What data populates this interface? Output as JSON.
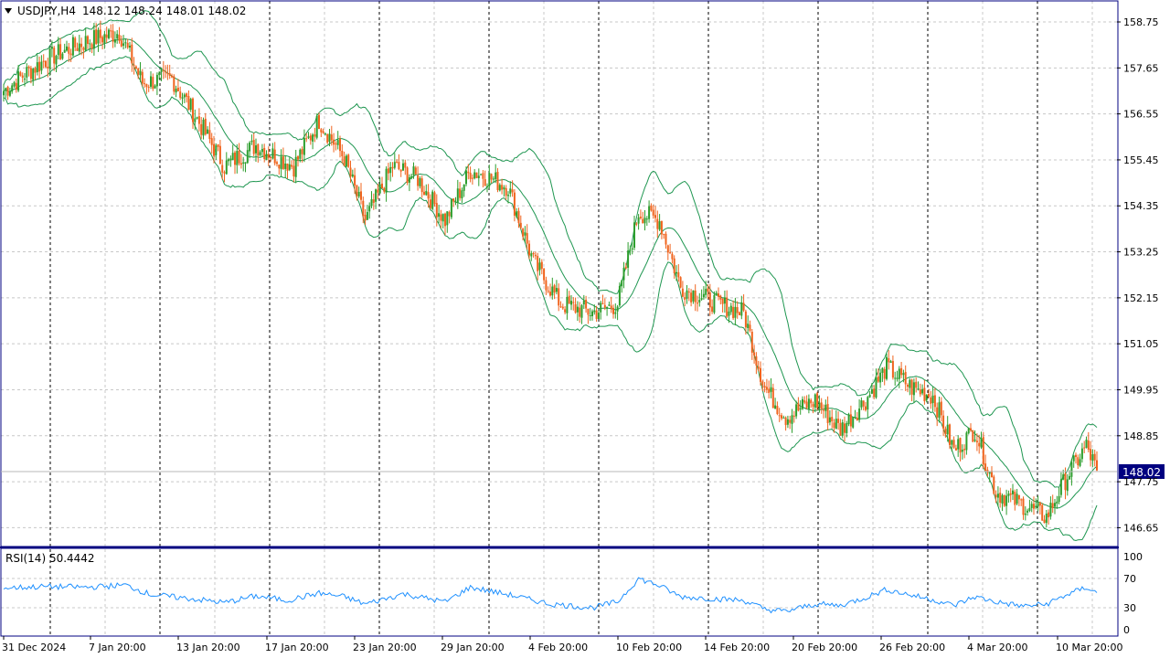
{
  "header": {
    "symbol": "USDJPY,H4",
    "ohlc": "148.12 148.24 148.01 148.02"
  },
  "price_panel": {
    "price_labels": [
      "158.75",
      "157.65",
      "156.55",
      "155.45",
      "154.35",
      "153.25",
      "152.15",
      "151.05",
      "149.95",
      "148.85",
      "147.75",
      "146.65"
    ],
    "current_price": "148.02",
    "current_price_bg": "#000080"
  },
  "rsi_panel": {
    "title": "RSI(14) 50.4442",
    "levels": [
      "100",
      "70",
      "30",
      "0"
    ],
    "line_color": "#1E90FF"
  },
  "time_labels": [
    "31 Dec 2024",
    "7 Jan 20:00",
    "13 Jan 20:00",
    "17 Jan 20:00",
    "23 Jan 20:00",
    "29 Jan 20:00",
    "4 Feb 20:00",
    "10 Feb 20:00",
    "14 Feb 20:00",
    "20 Feb 20:00",
    "26 Feb 20:00",
    "4 Mar 20:00",
    "10 Mar 20:00"
  ],
  "colors": {
    "bull": "#2E9E2E",
    "bear": "#F0641E",
    "bands": "#1E9650",
    "grid": "#C8C8C8",
    "separator": "#000080"
  },
  "chart_data": {
    "type": "candlestick",
    "symbol": "USDJPY",
    "timeframe": "H4",
    "indicators": [
      "Bollinger Bands",
      "RSI(14)"
    ],
    "y_range": [
      146.2,
      159.1
    ],
    "rsi_range": [
      0,
      100
    ],
    "rsi_value": 50.4442,
    "last_close": 148.02,
    "close_path": [
      [
        0,
        157.1
      ],
      [
        10,
        157.5
      ],
      [
        22,
        157.9
      ],
      [
        40,
        158.3
      ],
      [
        55,
        158.5
      ],
      [
        66,
        157.3
      ],
      [
        80,
        157.4
      ],
      [
        90,
        156.6
      ],
      [
        105,
        155.3
      ],
      [
        120,
        155.8
      ],
      [
        138,
        155.3
      ],
      [
        150,
        156.4
      ],
      [
        162,
        155.5
      ],
      [
        172,
        154.0
      ],
      [
        185,
        155.3
      ],
      [
        197,
        155.0
      ],
      [
        210,
        154.0
      ],
      [
        222,
        155.2
      ],
      [
        232,
        155.0
      ],
      [
        240,
        154.8
      ],
      [
        252,
        153.0
      ],
      [
        265,
        152.0
      ],
      [
        280,
        151.8
      ],
      [
        292,
        152.0
      ],
      [
        302,
        154.2
      ],
      [
        312,
        154.0
      ],
      [
        322,
        152.4
      ],
      [
        340,
        152.0
      ],
      [
        352,
        151.8
      ],
      [
        362,
        150.0
      ],
      [
        372,
        149.3
      ],
      [
        386,
        149.7
      ],
      [
        398,
        149.0
      ],
      [
        410,
        149.7
      ],
      [
        420,
        150.5
      ],
      [
        432,
        150.0
      ],
      [
        442,
        149.8
      ],
      [
        452,
        148.5
      ],
      [
        462,
        149.0
      ],
      [
        472,
        147.5
      ],
      [
        485,
        147.2
      ],
      [
        496,
        146.9
      ],
      [
        506,
        147.9
      ],
      [
        515,
        148.6
      ],
      [
        520,
        148.02
      ]
    ],
    "rsi_path": [
      [
        0,
        57
      ],
      [
        20,
        59
      ],
      [
        40,
        58
      ],
      [
        58,
        61
      ],
      [
        70,
        48
      ],
      [
        90,
        42
      ],
      [
        105,
        37
      ],
      [
        120,
        46
      ],
      [
        135,
        40
      ],
      [
        150,
        50
      ],
      [
        162,
        45
      ],
      [
        172,
        35
      ],
      [
        190,
        49
      ],
      [
        210,
        38
      ],
      [
        222,
        58
      ],
      [
        240,
        48
      ],
      [
        260,
        35
      ],
      [
        280,
        30
      ],
      [
        292,
        38
      ],
      [
        302,
        70
      ],
      [
        312,
        60
      ],
      [
        322,
        45
      ],
      [
        340,
        42
      ],
      [
        352,
        40
      ],
      [
        362,
        28
      ],
      [
        372,
        25
      ],
      [
        386,
        35
      ],
      [
        398,
        33
      ],
      [
        410,
        44
      ],
      [
        420,
        55
      ],
      [
        432,
        47
      ],
      [
        442,
        41
      ],
      [
        452,
        33
      ],
      [
        462,
        45
      ],
      [
        472,
        38
      ],
      [
        485,
        32
      ],
      [
        496,
        35
      ],
      [
        506,
        48
      ],
      [
        515,
        58
      ],
      [
        520,
        50.4
      ]
    ]
  }
}
